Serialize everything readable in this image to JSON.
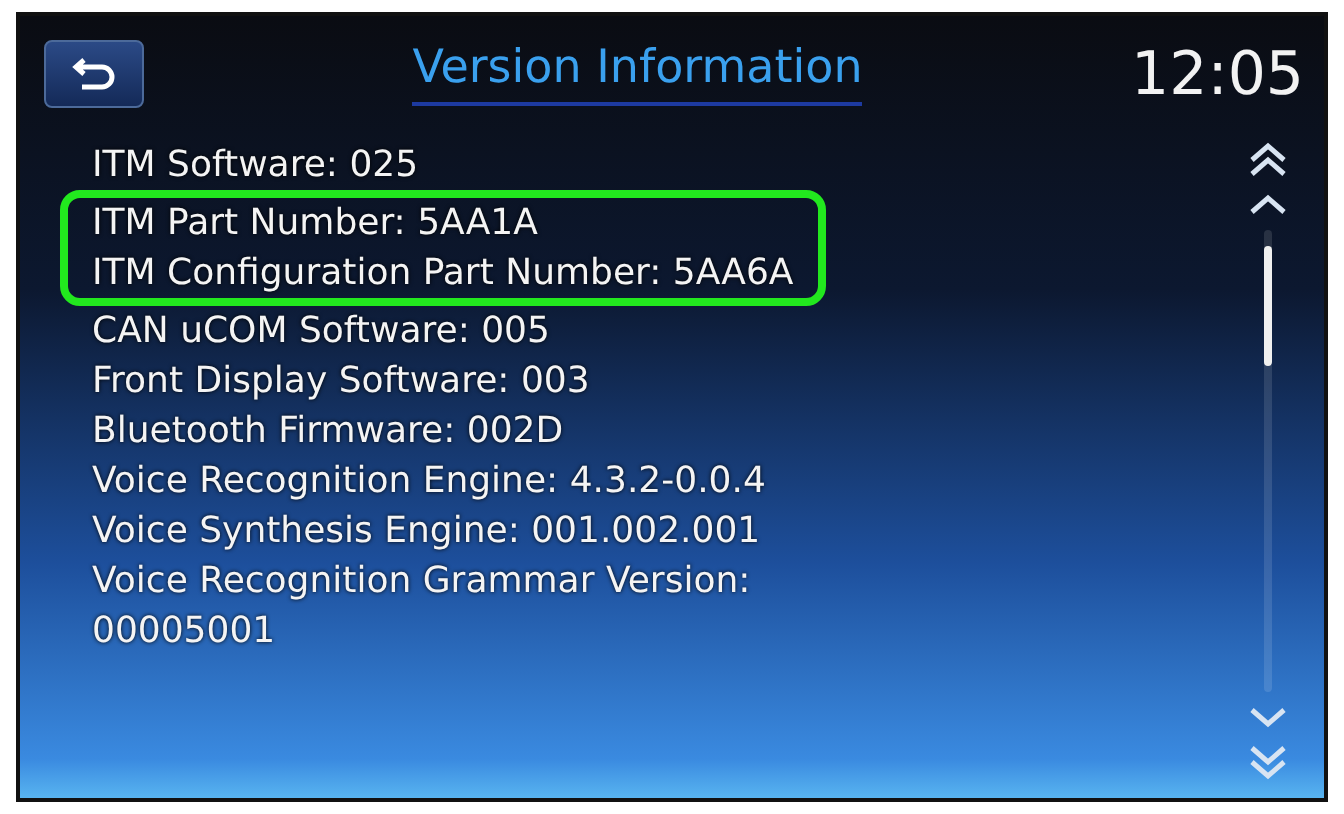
{
  "header": {
    "title": "Version Information",
    "time": "12:05"
  },
  "rows": [
    {
      "text": "ITM Software: 025",
      "highlighted": false
    },
    {
      "text": "ITM Part Number: 5AA1A",
      "highlighted": true
    },
    {
      "text": "ITM Configuration Part Number: 5AA6A",
      "highlighted": true
    },
    {
      "text": "CAN uCOM Software: 005",
      "highlighted": false
    },
    {
      "text": "Front Display Software: 003",
      "highlighted": false
    },
    {
      "text": "Bluetooth Firmware: 002D",
      "highlighted": false
    },
    {
      "text": "Voice Recognition Engine: 4.3.2-0.0.4",
      "highlighted": false
    },
    {
      "text": "Voice Synthesis Engine: 001.002.001",
      "highlighted": false
    },
    {
      "text": "Voice Recognition Grammar Version: 00005001",
      "highlighted": false
    }
  ]
}
